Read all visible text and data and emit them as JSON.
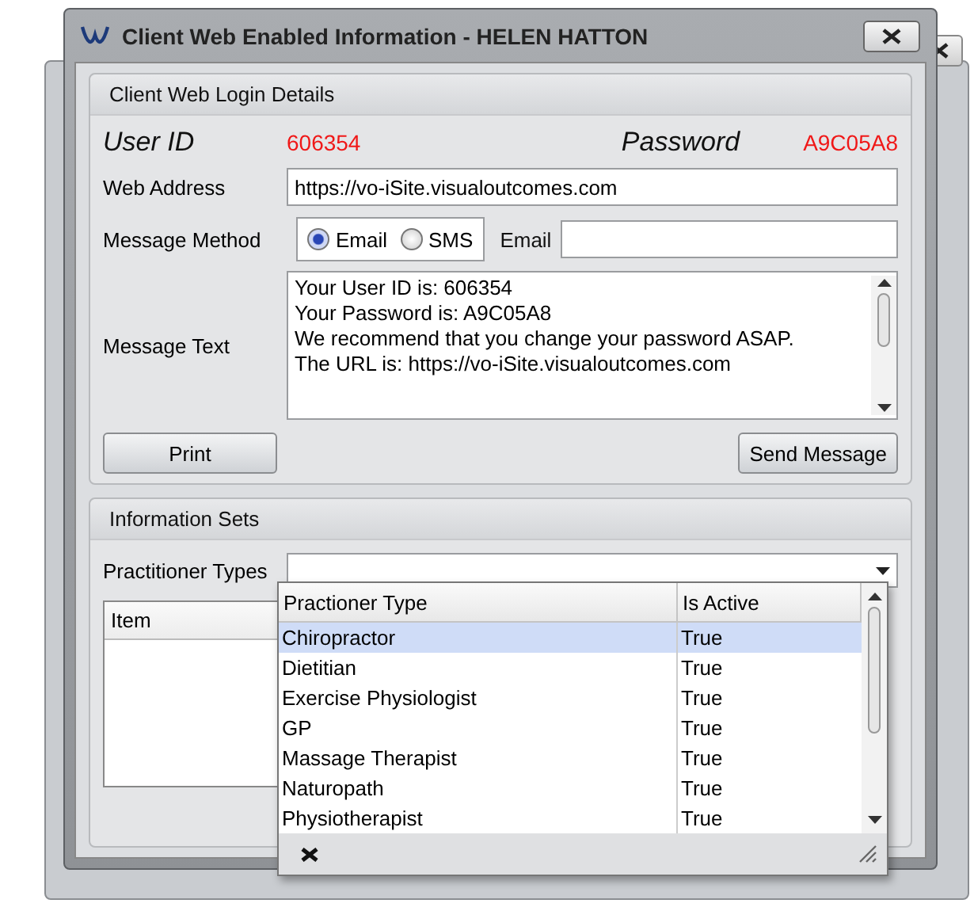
{
  "window": {
    "title": "Client Web Enabled Information - HELEN HATTON"
  },
  "login": {
    "heading": "Client Web Login Details",
    "user_id_label": "User ID",
    "user_id": "606354",
    "password_label": "Password",
    "password": "A9C05A8",
    "web_address_label": "Web Address",
    "web_address": "https://vo-iSite.visualoutcomes.com",
    "message_method_label": "Message Method",
    "methods": [
      {
        "label": "Email",
        "selected": true
      },
      {
        "label": "SMS",
        "selected": false
      }
    ],
    "email_label": "Email",
    "message_text_label": "Message Text",
    "message_lines": [
      "Your User ID is: 606354",
      "Your Password is: A9C05A8",
      "We recommend that you change your password ASAP.",
      "The URL is: https://vo-iSite.visualoutcomes.com"
    ],
    "print_button": "Print",
    "send_button": "Send Message"
  },
  "info": {
    "heading": "Information Sets",
    "practitioner_types_label": "Practitioner Types",
    "item_column": "Item",
    "dropdown": {
      "columns": [
        "Practioner Type",
        "Is Active"
      ],
      "rows": [
        {
          "type": "Chiropractor",
          "active": "True",
          "selected": true
        },
        {
          "type": "Dietitian",
          "active": "True",
          "selected": false
        },
        {
          "type": "Exercise Physiologist",
          "active": "True",
          "selected": false
        },
        {
          "type": "GP",
          "active": "True",
          "selected": false
        },
        {
          "type": "Massage Therapist",
          "active": "True",
          "selected": false
        },
        {
          "type": "Naturopath",
          "active": "True",
          "selected": false
        },
        {
          "type": "Physiotherapist",
          "active": "True",
          "selected": false
        }
      ]
    }
  }
}
